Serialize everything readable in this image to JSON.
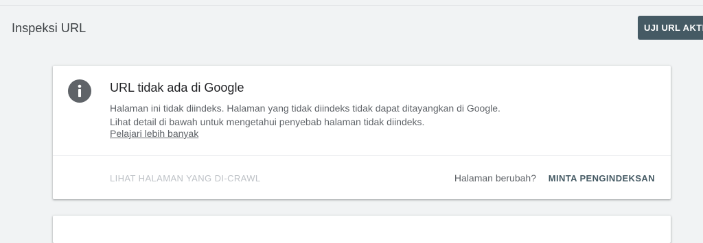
{
  "header": {
    "title": "Inspeksi URL",
    "test_live_label": "UJI URL AKTIF"
  },
  "status_card": {
    "icon": "info-icon",
    "title": "URL tidak ada di Google",
    "description": "Halaman ini tidak diindeks. Halaman yang tidak diindeks tidak dapat ditayangkan di Google. Lihat detail di bawah untuk mengetahui penyebab halaman tidak diindeks.",
    "learn_more": "Pelajari lebih banyak",
    "view_crawled": "LIHAT HALAMAN YANG DI-CRAWL",
    "page_changed": "Halaman berubah?",
    "request_indexing": "MINTA PENGINDEKSAN"
  },
  "colors": {
    "background": "#f1f3f4",
    "button_dark": "#455a64",
    "icon_grey": "#5f6368"
  }
}
